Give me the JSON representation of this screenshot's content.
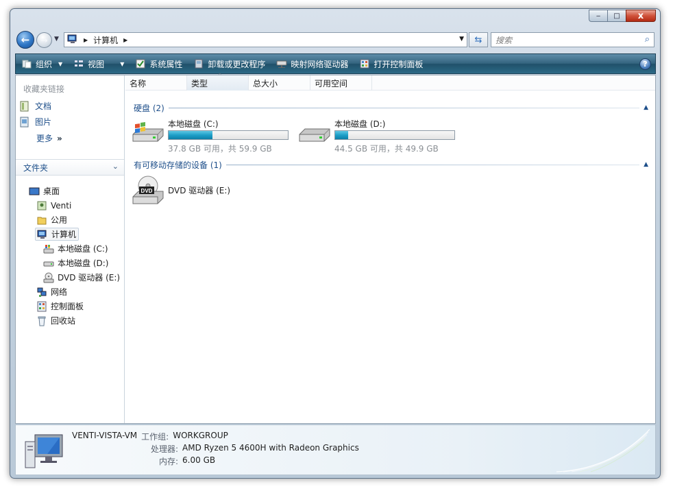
{
  "window": {
    "caption_buttons": {
      "minimize": "‒",
      "maximize": "□",
      "close": "x"
    }
  },
  "address_bar": {
    "crumbs": [
      "计算机"
    ],
    "search_placeholder": "搜索"
  },
  "toolbar": {
    "organize": "组织",
    "views": "视图",
    "system_properties": "系统属性",
    "uninstall": "卸载或更改程序",
    "map_drive": "映射网络驱动器",
    "control_panel": "打开控制面板"
  },
  "favorites": {
    "title": "收藏夹链接",
    "items": [
      "文档",
      "图片"
    ],
    "more": "更多"
  },
  "folders": {
    "title": "文件夹",
    "tree": [
      "桌面",
      "Venti",
      "公用",
      "计算机",
      "本地磁盘 (C:)",
      "本地磁盘 (D:)",
      "DVD 驱动器 (E:)",
      "网络",
      "控制面板",
      "回收站"
    ]
  },
  "columns": [
    "名称",
    "类型",
    "总大小",
    "可用空间"
  ],
  "groups": {
    "hard_disks": "硬盘 (2)",
    "removable": "有可移动存储的设备 (1)"
  },
  "drives": [
    {
      "name": "本地磁盘 (C:)",
      "free_text": "37.8 GB 可用，共 59.9 GB",
      "used_fraction": 0.37
    },
    {
      "name": "本地磁盘 (D:)",
      "free_text": "44.5 GB 可用，共 49.9 GB",
      "used_fraction": 0.11
    }
  ],
  "dvd": {
    "name": "DVD 驱动器 (E:)",
    "badge": "DVD"
  },
  "details": {
    "computer_name": "VENTI-VISTA-VM",
    "workgroup_label": "工作组:",
    "workgroup": "WORKGROUP",
    "processor_label": "处理器:",
    "processor": "AMD Ryzen 5 4600H with Radeon Graphics",
    "memory_label": "内存:",
    "memory": "6.00 GB"
  },
  "colors": {
    "accent": "#1e4f8a",
    "bar_fill": "#1d9fc8",
    "cmdbar": "#2c6a86"
  }
}
